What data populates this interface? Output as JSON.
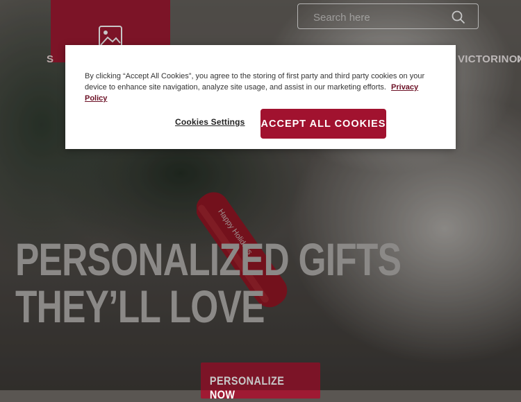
{
  "header": {
    "nav_left_label": "S",
    "nav_right_label": "VICTORINOX",
    "nav_right_partial": "I",
    "search": {
      "placeholder": "Search here",
      "value": ""
    }
  },
  "hero": {
    "title_line1": "PERSONALIZED GIFTS",
    "title_line2": "THEY’LL LOVE",
    "cta_label": "PERSONALIZE NOW",
    "knife_engraving": "Happy Holidays"
  },
  "cookie_banner": {
    "message": "By clicking “Accept All Cookies”, you agree to the storing of first party and third party cookies on your device to enhance site navigation, analyze site usage, and assist in our marketing efforts.",
    "privacy_link_label": "Privacy Policy",
    "settings_label": "Cookies Settings",
    "accept_label": "ACCEPT ALL COOKIES"
  },
  "icons": {
    "logo": "image-placeholder-icon",
    "search": "search-icon"
  },
  "colors": {
    "brand_red": "#9f1a33",
    "accept_red": "#a1122f",
    "link_red": "#6b0f24"
  }
}
